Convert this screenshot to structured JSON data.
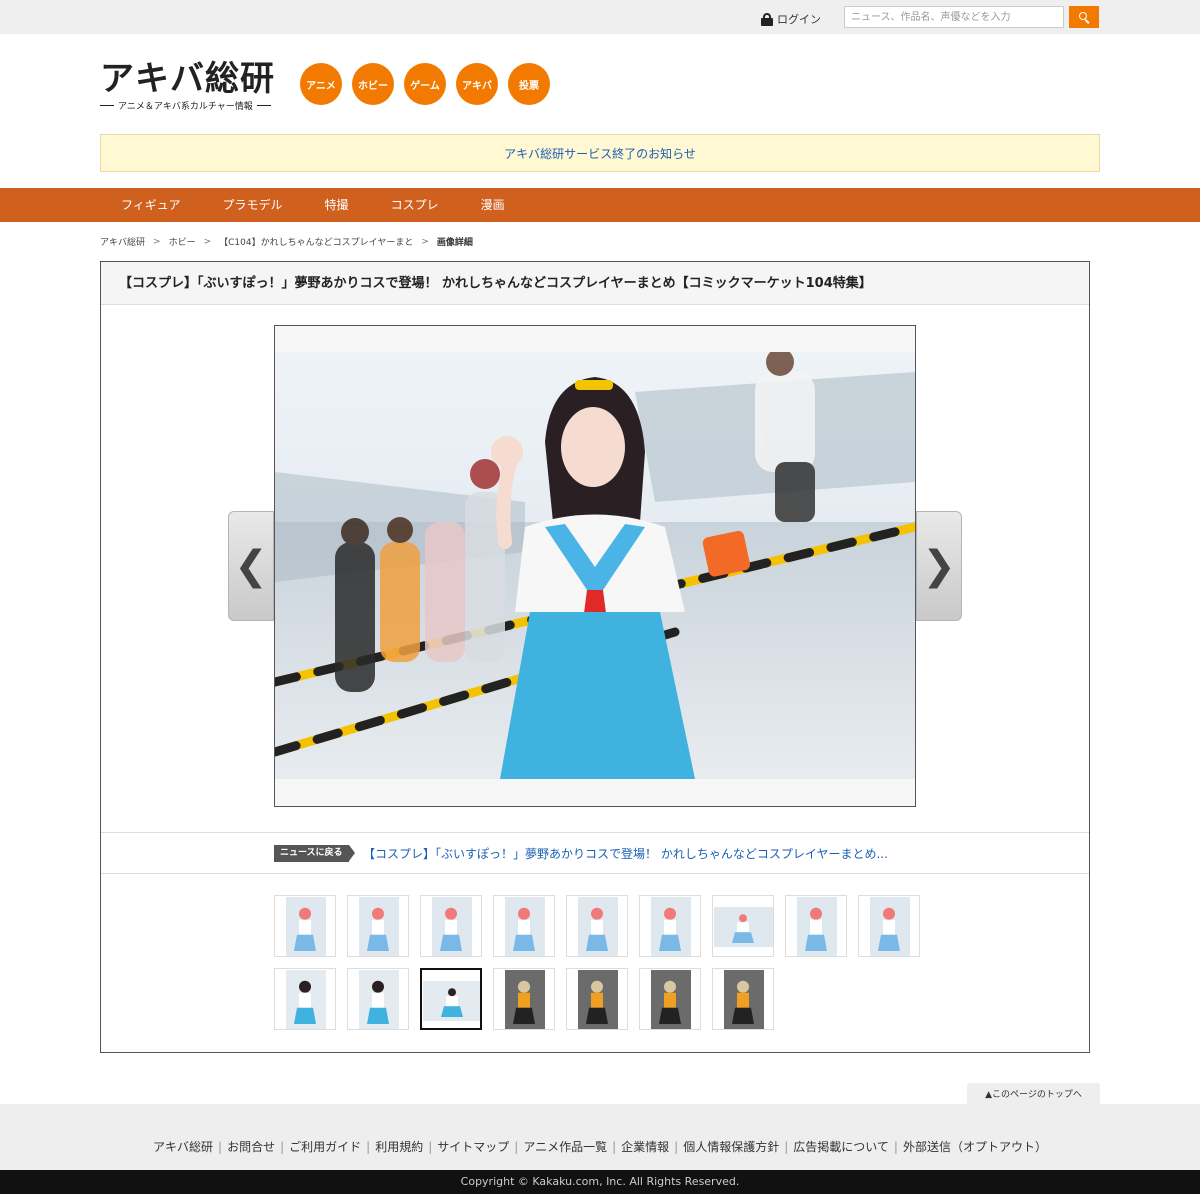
{
  "topbar": {
    "login_label": "ログイン",
    "search_placeholder": "ニュース、作品名、声優などを入力"
  },
  "logo": {
    "main": "アキバ総研",
    "sub": "アニメ＆アキバ系カルチャー情報"
  },
  "categories": [
    "アニメ",
    "ホビー",
    "ゲーム",
    "アキバ",
    "投票"
  ],
  "notice": "アキバ総研サービス終了のお知らせ",
  "nav": [
    "フィギュア",
    "プラモデル",
    "特撮",
    "コスプレ",
    "漫画"
  ],
  "breadcrumb": [
    "アキバ総研",
    "ホビー",
    "【C104】かれしちゃんなどコスプレイヤーまと",
    "画像詳細"
  ],
  "article": {
    "title": "【コスプレ】「ぶいすぽっ！」夢野あかりコスで登場！ かれしちゃんなどコスプレイヤーまとめ【コミックマーケット104特集】",
    "back_badge": "ニュースに戻る",
    "back_link": "【コスプレ】「ぶいすぽっ！」夢野あかりコスで登場！ かれしちゃんなどコスプレイヤーまとめ..."
  },
  "viewer": {
    "prev_glyph": "❮",
    "next_glyph": "❯",
    "selected_thumb_index": 11
  },
  "thumbnails": [
    {
      "palette": "pink"
    },
    {
      "palette": "pink"
    },
    {
      "palette": "pink"
    },
    {
      "palette": "pink"
    },
    {
      "palette": "pink"
    },
    {
      "palette": "pink"
    },
    {
      "palette": "pink"
    },
    {
      "palette": "pink"
    },
    {
      "palette": "pink"
    },
    {
      "palette": "blue"
    },
    {
      "palette": "blue"
    },
    {
      "palette": "blue"
    },
    {
      "palette": "dark"
    },
    {
      "palette": "dark"
    },
    {
      "palette": "dark"
    },
    {
      "palette": "dark"
    }
  ],
  "page_top_label": "▲このページのトップへ",
  "footer_links": [
    "アキバ総研",
    "お問合せ",
    "ご利用ガイド",
    "利用規約",
    "サイトマップ",
    "アニメ作品一覧",
    "企業情報",
    "個人情報保護方針",
    "広告掲載について",
    "外部送信（オプトアウト）"
  ],
  "copyright": "Copyright © Kakaku.com, Inc. All Rights Reserved.",
  "colors": {
    "accent": "#f27a00",
    "nav_bg": "#cf601e",
    "notice_bg": "#fff8d2",
    "link": "#1a5fb4"
  }
}
